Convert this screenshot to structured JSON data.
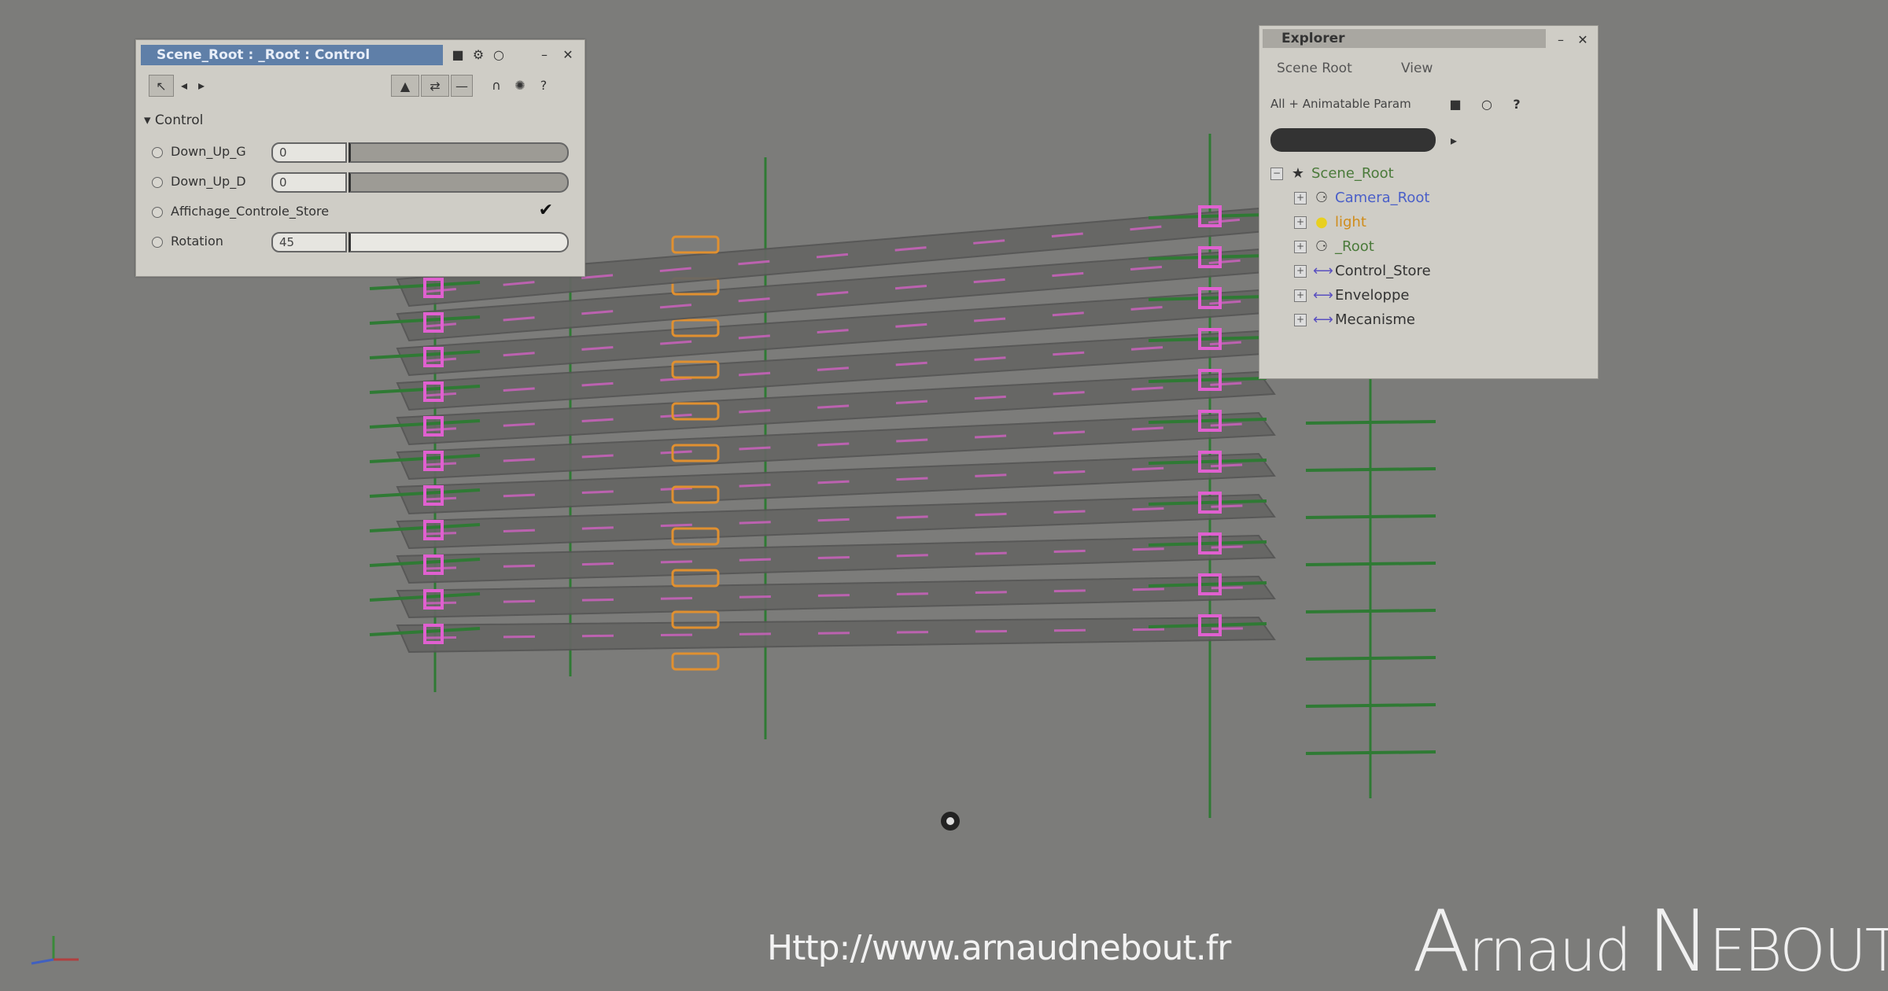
{
  "property_panel": {
    "title": "Scene_Root : _Root : Control",
    "section": "▾ Control",
    "params": [
      {
        "label": "Down_Up_G",
        "value": "0"
      },
      {
        "label": "Down_Up_D",
        "value": "0"
      },
      {
        "label": "Affichage_Controle_Store",
        "checked": true
      },
      {
        "label": "Rotation",
        "value": "45"
      }
    ]
  },
  "explorer": {
    "title": "Explorer",
    "menu": [
      "Scene Root",
      "View"
    ],
    "filter": "All + Animatable Param",
    "tree": [
      {
        "label": "Scene_Root",
        "icon": "scene-root-icon",
        "color": "#4a7a3a",
        "indent": 0
      },
      {
        "label": "Camera_Root",
        "icon": "camera-null-icon",
        "color": "#4a5fc8",
        "indent": 1
      },
      {
        "label": "light",
        "icon": "light-bulb-icon",
        "color": "#d08c1a",
        "indent": 1
      },
      {
        "label": "_Root",
        "icon": "null-icon",
        "color": "#4a7a3a",
        "indent": 1
      },
      {
        "label": "Control_Store",
        "icon": "curve-icon",
        "color": "#333333",
        "indent": 1
      },
      {
        "label": "Enveloppe",
        "icon": "curve-icon",
        "color": "#333333",
        "indent": 1
      },
      {
        "label": "Mecanisme",
        "icon": "curve-icon",
        "color": "#333333",
        "indent": 1
      }
    ]
  },
  "overlay": {
    "url": "Http://www.arnaudnebout.fr",
    "signature_a": "A",
    "signature_rest1": "rnaud ",
    "signature_n": "N",
    "signature_rest2": "EBOUT"
  },
  "slats": {
    "count": 11
  },
  "colors": {
    "viewport_bg": "#7c7c7a",
    "slat": "#666664",
    "pink": "#e060d0",
    "green": "#2f7a34",
    "orange": "#e09030"
  }
}
